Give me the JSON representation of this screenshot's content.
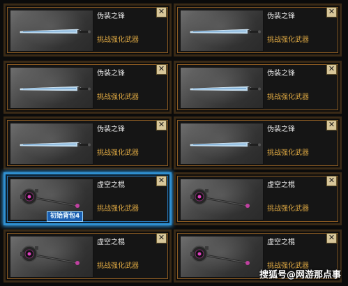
{
  "cards": [
    {
      "name": "伪装之锋",
      "task": "挑战强化武器",
      "weapon": "sword",
      "selected": false,
      "tag": null
    },
    {
      "name": "伪装之锋",
      "task": "挑战强化武器",
      "weapon": "sword",
      "selected": false,
      "tag": null
    },
    {
      "name": "伪装之锋",
      "task": "挑战强化武器",
      "weapon": "sword",
      "selected": false,
      "tag": null
    },
    {
      "name": "伪装之锋",
      "task": "挑战强化武器",
      "weapon": "sword",
      "selected": false,
      "tag": null
    },
    {
      "name": "伪装之锋",
      "task": "挑战强化武器",
      "weapon": "sword",
      "selected": false,
      "tag": null
    },
    {
      "name": "伪装之锋",
      "task": "挑战强化武器",
      "weapon": "sword",
      "selected": false,
      "tag": null
    },
    {
      "name": "虚空之棍",
      "task": "挑战强化武器",
      "weapon": "staff",
      "selected": true,
      "tag": "初始背包4"
    },
    {
      "name": "虚空之棍",
      "task": "挑战强化武器",
      "weapon": "staff",
      "selected": false,
      "tag": null
    },
    {
      "name": "虚空之棍",
      "task": "挑战强化武器",
      "weapon": "staff",
      "selected": false,
      "tag": null
    },
    {
      "name": "虚空之棍",
      "task": "挑战强化武器",
      "weapon": "staff",
      "selected": false,
      "tag": null
    }
  ],
  "close_label": "✕",
  "watermark": "搜狐号@网游那点事",
  "colors": {
    "accent_orange": "#8a5a22",
    "selected_blue": "#2f8fd0",
    "task_text": "#d8a441",
    "name_text": "#ececec"
  }
}
